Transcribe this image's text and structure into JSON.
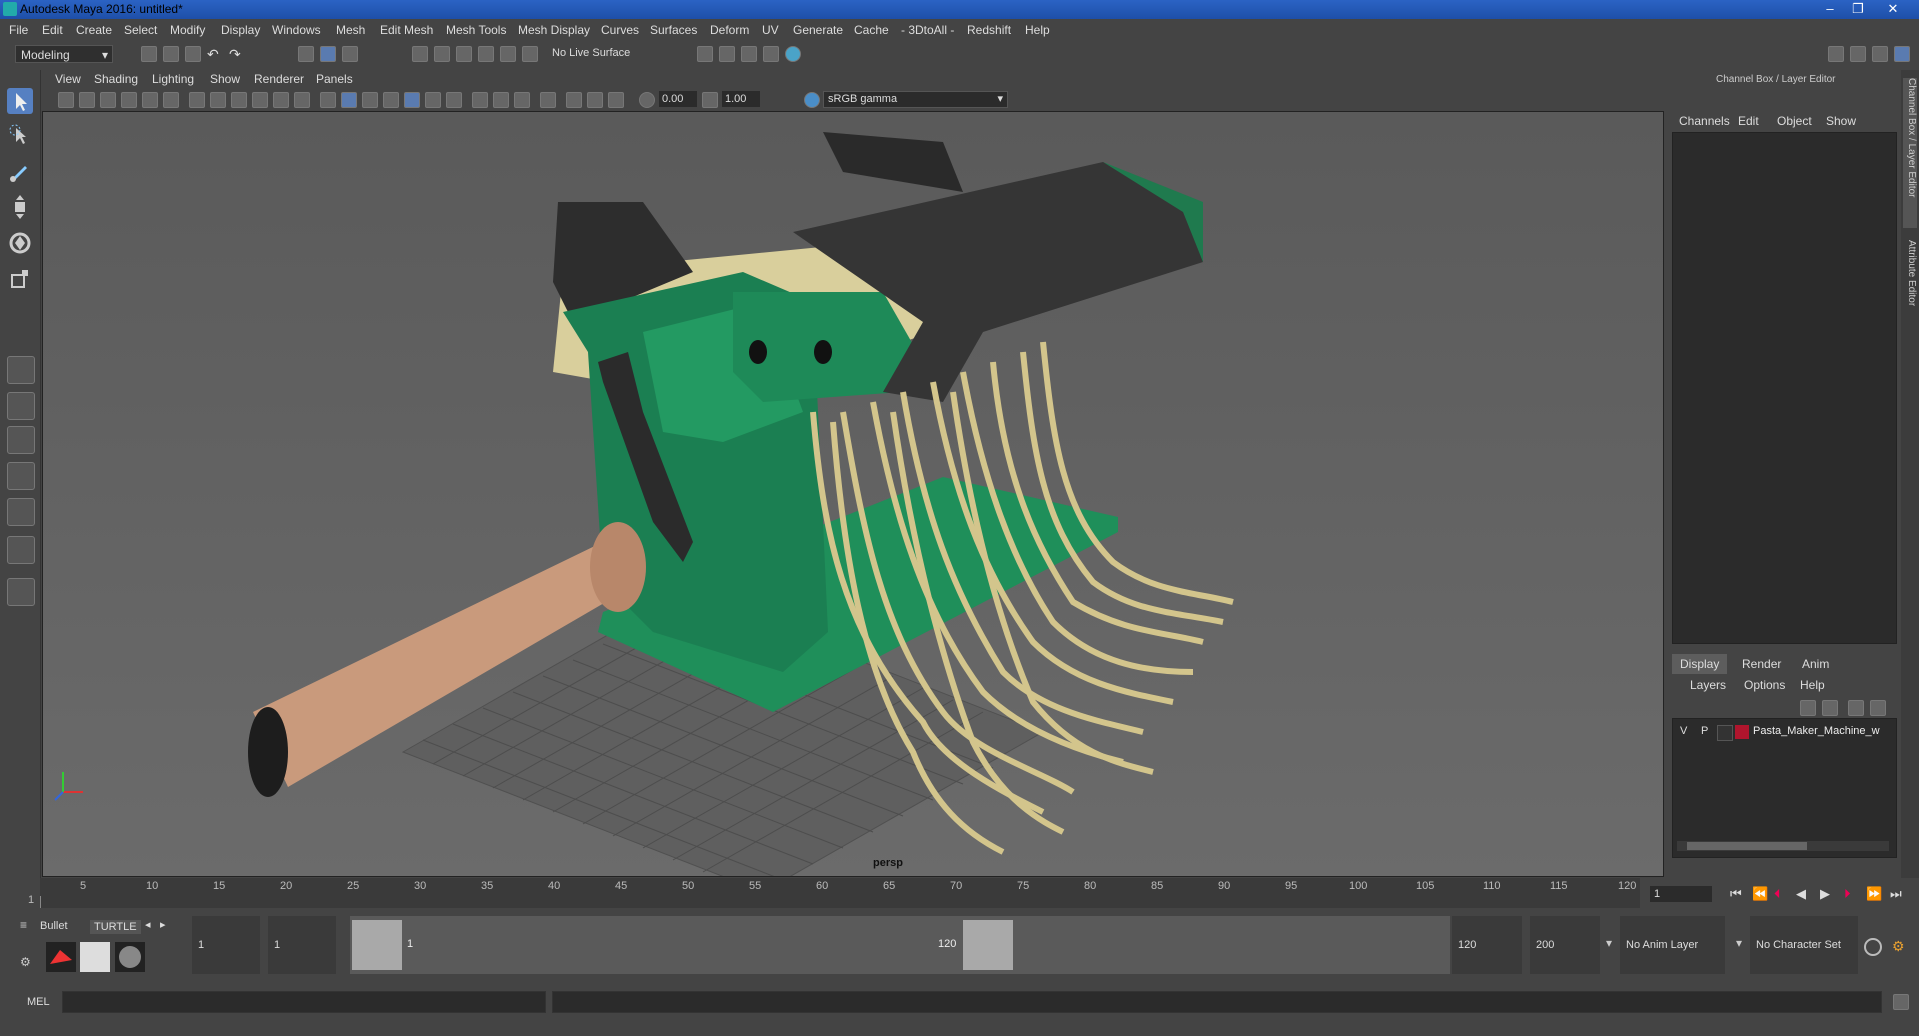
{
  "window": {
    "title": "Autodesk Maya 2016: untitled*"
  },
  "menu": [
    "File",
    "Edit",
    "Create",
    "Select",
    "Modify",
    "Display",
    "Windows",
    "Mesh",
    "Edit Mesh",
    "Mesh Tools",
    "Mesh Display",
    "Curves",
    "Surfaces",
    "Deform",
    "UV",
    "Generate",
    "Cache",
    "- 3DtoAll -",
    "Redshift",
    "Help"
  ],
  "status": {
    "mode": "Modeling",
    "live_surface": "No Live Surface"
  },
  "panel_menu": [
    "View",
    "Shading",
    "Lighting",
    "Show",
    "Renderer",
    "Panels"
  ],
  "view_tools": {
    "exposure": "0.00",
    "gamma": "1.00",
    "color_space": "sRGB gamma"
  },
  "viewport": {
    "camera": "persp"
  },
  "right_panel": {
    "header": "Channel Box / Layer Editor",
    "menu": [
      "Channels",
      "Edit",
      "Object",
      "Show"
    ],
    "tabs": [
      "Display",
      "Render",
      "Anim"
    ],
    "layer_menu": [
      "Layers",
      "Options",
      "Help"
    ],
    "layer": {
      "v": "V",
      "p": "P",
      "name": "Pasta_Maker_Machine_w",
      "color": "#b0152d"
    },
    "side_tabs": [
      "Channel Box / Layer Editor",
      "Attribute Editor"
    ]
  },
  "timeline": {
    "ticks": [
      "1",
      "5",
      "10",
      "15",
      "20",
      "25",
      "30",
      "35",
      "40",
      "45",
      "50",
      "55",
      "60",
      "65",
      "70",
      "75",
      "80",
      "85",
      "90",
      "95",
      "100",
      "105",
      "110",
      "115",
      "120"
    ],
    "current_frame": "1"
  },
  "range": {
    "start": "1",
    "inner_start": "1",
    "handle_start": "1",
    "handle_end": "120",
    "end": "120",
    "outer_end": "200",
    "anim_layer": "No Anim Layer",
    "character_set": "No Character Set"
  },
  "shelf": {
    "tab1": "Bullet",
    "tab2": "TURTLE"
  },
  "command": {
    "label": "MEL"
  },
  "colors": {
    "accent": "#2b63c4",
    "machine_green": "#1f8f5a",
    "pasta": "#d9cf9c"
  }
}
